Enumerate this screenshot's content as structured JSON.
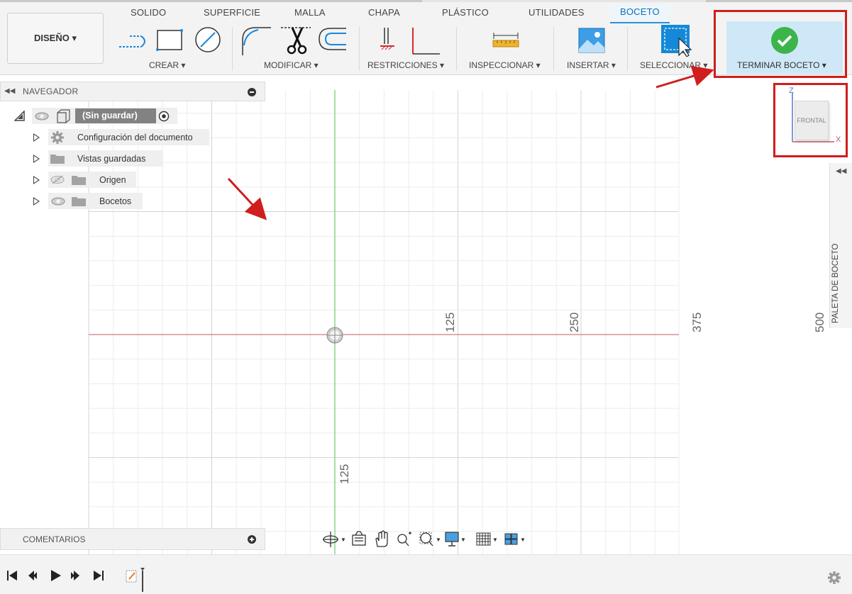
{
  "toolbar": {
    "tabs": [
      "SOLIDO",
      "SUPERFICIE",
      "MALLA",
      "CHAPA",
      "PLÁSTICO",
      "UTILIDADES",
      "BOCETO"
    ],
    "workspace_label": "DISEÑO ▾",
    "groups": {
      "create": "CREAR ▾",
      "modify": "MODIFICAR ▾",
      "constraints": "RESTRICCIONES ▾",
      "inspect": "INSPECCIONAR ▾",
      "insert": "INSERTAR ▾",
      "select": "SELECCIONAR ▾",
      "finish": "TERMINAR BOCETO ▾"
    }
  },
  "navigator": {
    "title": "NAVEGADOR",
    "root": "(Sin guardar)",
    "items": [
      "Configuración del documento",
      "Vistas guardadas",
      "Origen",
      "Bocetos"
    ]
  },
  "comments": {
    "title": "COMENTARIOS"
  },
  "palette": {
    "title": "PALETA DE BOCETO"
  },
  "viewcube": {
    "face": "FRONTAL",
    "axis_z": "Z",
    "axis_x": "X"
  },
  "canvas": {
    "labels_x": [
      "125",
      "250",
      "375",
      "500"
    ],
    "label_y": "125"
  },
  "colors": {
    "accent": "#2d8fd5",
    "finish_bg": "#cfe8f7",
    "check": "#3bb54a",
    "annotation": "#d01d1d",
    "axis_x": "#d27a7a",
    "axis_y": "#7fd67f"
  },
  "icons": {
    "timeline": [
      "skip-start-icon",
      "step-back-icon",
      "play-icon",
      "step-forward-icon",
      "skip-end-icon",
      "sketch-marker-icon"
    ],
    "settings": "gear-icon"
  }
}
